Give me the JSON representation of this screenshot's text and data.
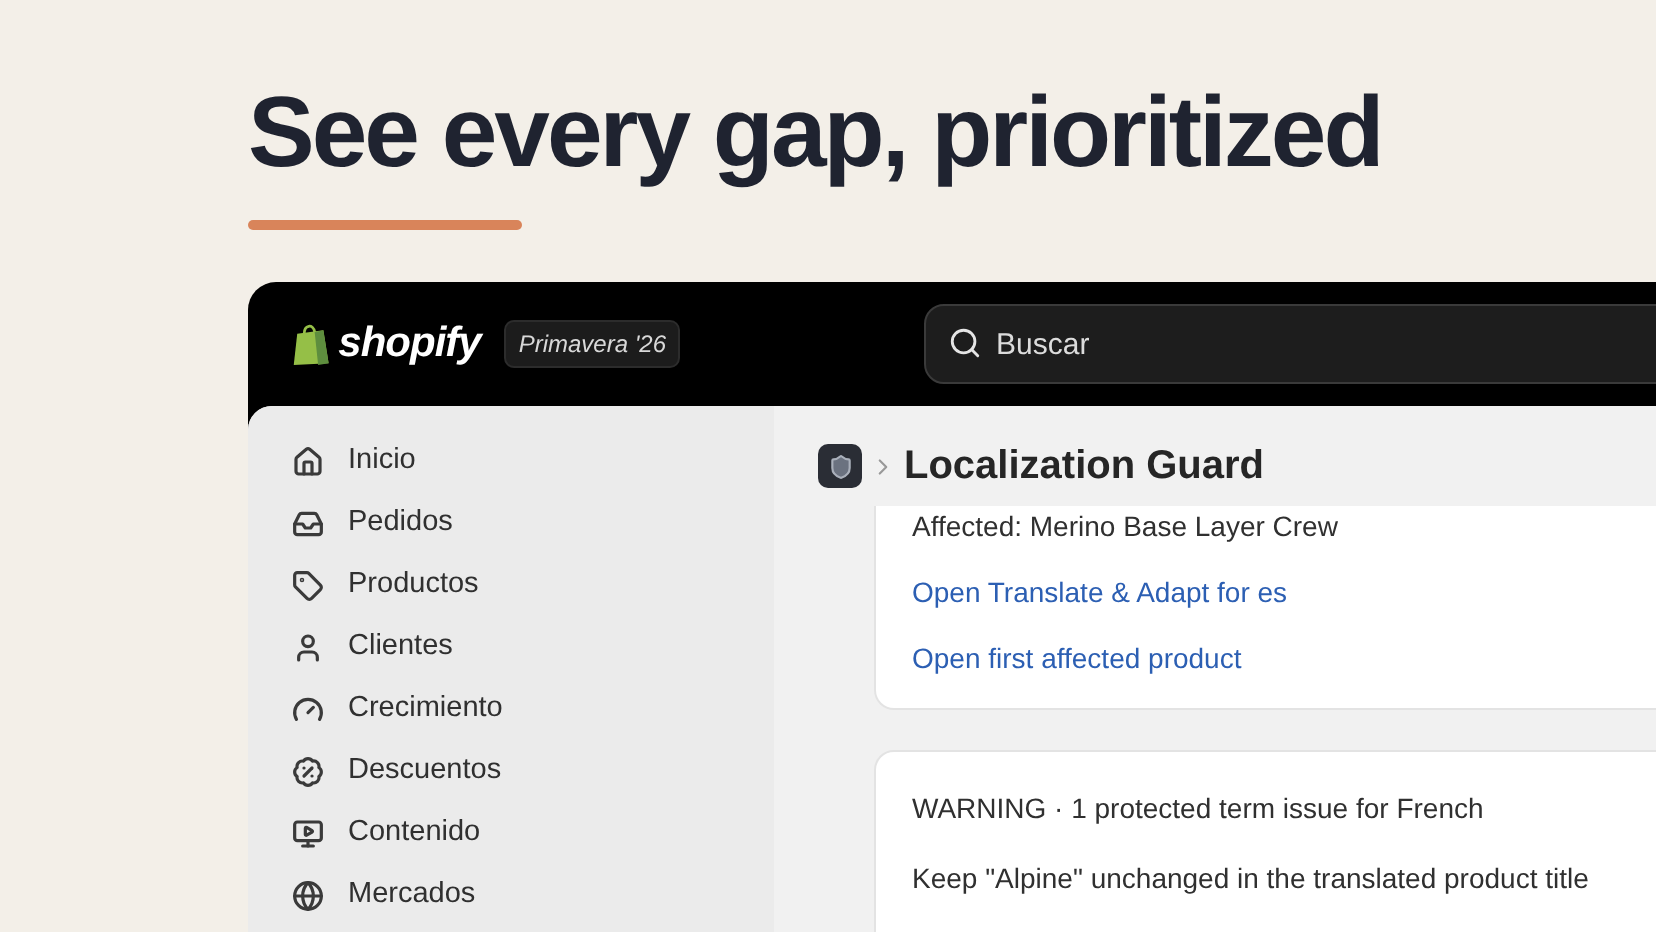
{
  "headline": "See every gap, prioritized",
  "topbar": {
    "brand": "shopify",
    "edition": "Primavera '26",
    "search": {
      "placeholder": "Buscar"
    }
  },
  "sidebar": {
    "items": [
      {
        "label": "Inicio",
        "kind": "home"
      },
      {
        "label": "Pedidos",
        "kind": "inbox"
      },
      {
        "label": "Productos",
        "kind": "tag"
      },
      {
        "label": "Clientes",
        "kind": "user"
      },
      {
        "label": "Crecimiento",
        "kind": "gauge"
      },
      {
        "label": "Descuentos",
        "kind": "discount"
      },
      {
        "label": "Contenido",
        "kind": "content"
      },
      {
        "label": "Mercados",
        "kind": "globe"
      }
    ]
  },
  "page": {
    "title": "Localization Guard",
    "cards": [
      {
        "lines": [
          {
            "kind": "text",
            "text": "Affected: Merino Base Layer Crew"
          },
          {
            "kind": "link",
            "text": "Open Translate & Adapt for es"
          },
          {
            "kind": "link",
            "text": "Open first affected product"
          }
        ]
      },
      {
        "lines": [
          {
            "kind": "text",
            "text": "WARNING · 1 protected term issue for French"
          },
          {
            "kind": "text",
            "text": "Keep \"Alpine\" unchanged in the translated product title"
          }
        ]
      }
    ]
  }
}
